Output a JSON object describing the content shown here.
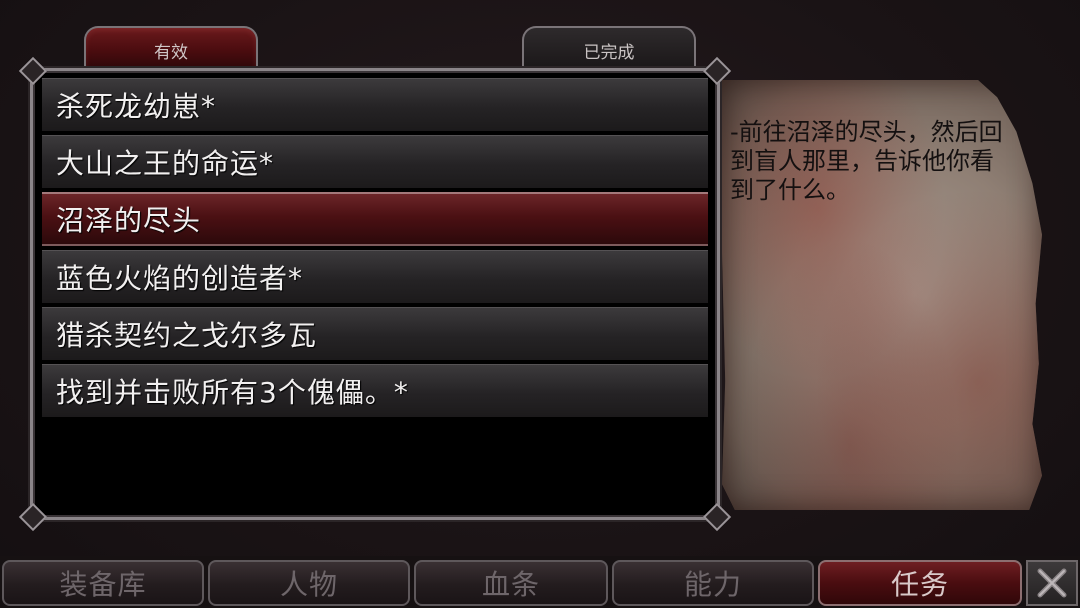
{
  "tabs": {
    "active": "有效",
    "completed": "已完成"
  },
  "quests": [
    {
      "label": "杀死龙幼崽*"
    },
    {
      "label": "大山之王的命运*"
    },
    {
      "label": "沼泽的尽头"
    },
    {
      "label": "蓝色火焰的创造者*"
    },
    {
      "label": "猎杀契约之戈尔多瓦"
    },
    {
      "label": "找到并击败所有3个傀儡。*"
    }
  ],
  "selected_quest_index": 2,
  "quest_description": "-前往沼泽的尽头，然后回到盲人那里，告诉他你看到了什么。",
  "nav": [
    {
      "label": "装备库"
    },
    {
      "label": "人物"
    },
    {
      "label": "血条"
    },
    {
      "label": "能力"
    },
    {
      "label": "任务"
    }
  ],
  "active_nav_index": 4,
  "icons": {
    "close": "close-icon"
  },
  "colors": {
    "accent_red": "#4a0c0f",
    "selected_row": "#4b1013",
    "parchment": "#8f7f74",
    "text_light": "#f2f0f0"
  }
}
